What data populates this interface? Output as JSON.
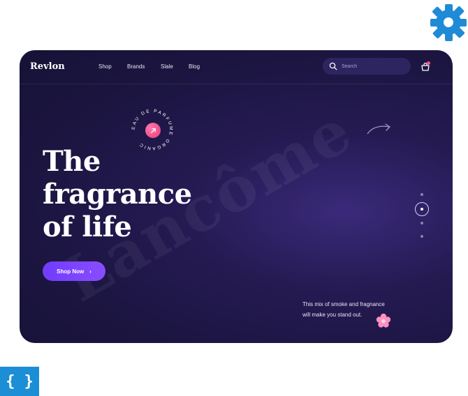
{
  "brand": {
    "name": "Revlon"
  },
  "nav": {
    "items": [
      "Shop",
      "Brands",
      "Slale",
      "Blog"
    ]
  },
  "search": {
    "placeholder": "Search"
  },
  "badge": {
    "text": "EAU DE PARFUME ORGANIC"
  },
  "hero": {
    "headline": [
      "The",
      "fragrance",
      "of life"
    ],
    "cta_label": "Shop Now",
    "cta_arrow": "›",
    "watermark": "Lancôme",
    "tagline": [
      "This mix of smoke and fragnance",
      "will make you stand out."
    ]
  },
  "slider": {
    "count": 4,
    "active_index": 1
  },
  "icons": [
    "gear-icon",
    "code-brackets-icon",
    "search-icon",
    "cart-icon",
    "arrow-up-right-icon",
    "curved-arrow-icon",
    "flower-icon"
  ],
  "colors": {
    "background": "#1b1540",
    "accent": "#7a45ff",
    "pink": "#e63a77",
    "text": "#ffffff"
  },
  "decor": {
    "brackets": "{ }"
  }
}
